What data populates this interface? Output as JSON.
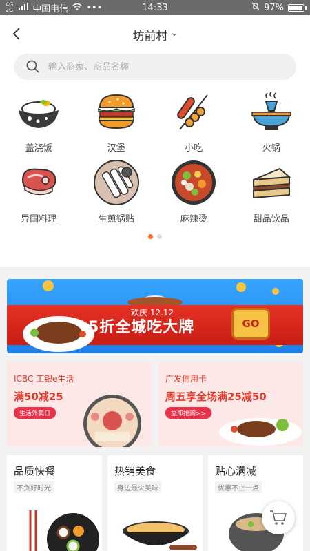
{
  "status_bar": {
    "network": "4G",
    "network2": "2G",
    "carrier": "中国电信",
    "dots": "•••",
    "time": "14:33",
    "battery": "97%",
    "battery_level": 0.97
  },
  "header": {
    "title": "坊前村"
  },
  "search": {
    "placeholder": "输入商家、商品名称"
  },
  "categories": [
    {
      "label": "盖浇饭",
      "icon": "rice-bowl-icon"
    },
    {
      "label": "汉堡",
      "icon": "burger-icon"
    },
    {
      "label": "小吃",
      "icon": "skewer-icon"
    },
    {
      "label": "火锅",
      "icon": "hotpot-icon"
    },
    {
      "label": "异国料理",
      "icon": "steak-icon"
    },
    {
      "label": "生煎锅贴",
      "icon": "dumpling-plate-icon"
    },
    {
      "label": "麻辣烫",
      "icon": "spicy-bowl-icon"
    },
    {
      "label": "甜品饮品",
      "icon": "cake-icon"
    }
  ],
  "pager": {
    "pages": 2,
    "active": 0
  },
  "banner": {
    "subtitle": "欢庆 12.12",
    "headline": "5折全城吃大牌",
    "button": "GO"
  },
  "promos": [
    {
      "brand": "ICBC 工银e生活",
      "offer": "满50减25",
      "button": "生活外卖日"
    },
    {
      "brand": "广发信用卡",
      "offer": "周五享全场满25减50",
      "button": "立即抢购>>"
    }
  ],
  "features": [
    {
      "title": "品质快餐",
      "subtitle": "不负好时光"
    },
    {
      "title": "热销美食",
      "subtitle": "身边最火美味"
    },
    {
      "title": "贴心满减",
      "subtitle": "优惠不止一点"
    }
  ],
  "colors": {
    "accent": "#ff6a2a",
    "promo_red": "#e13b2b",
    "banner_blue": "#2a8df0"
  }
}
